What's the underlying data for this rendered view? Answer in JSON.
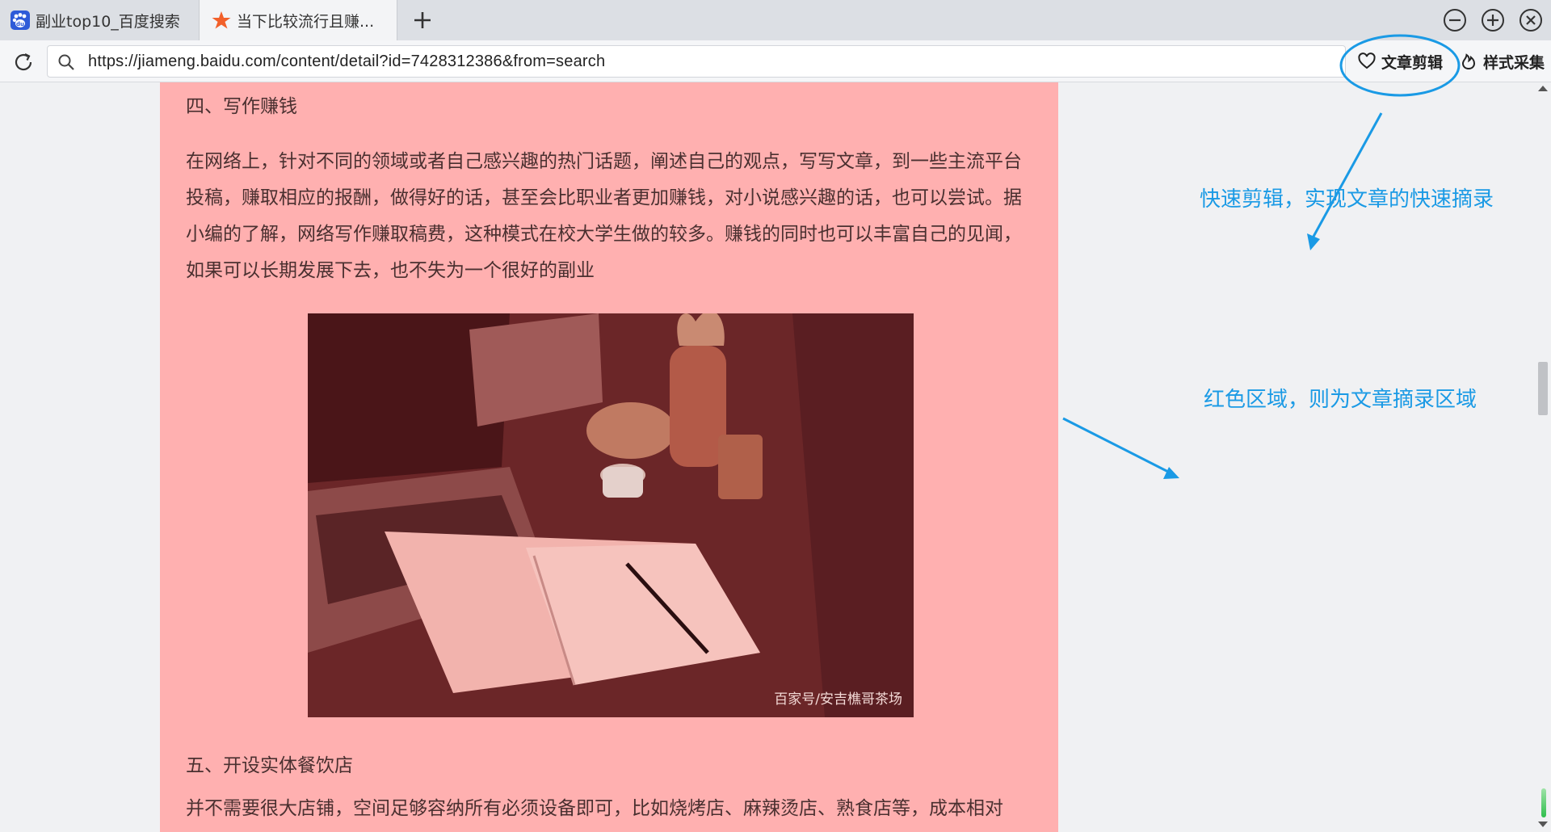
{
  "tabs": [
    {
      "title": "副业top10_百度搜索",
      "icon": "baidu-paw-icon",
      "active": false
    },
    {
      "title": "当下比较流行且赚...",
      "icon": "orange-star-icon",
      "active": true
    }
  ],
  "window_controls": [
    "minimize-icon",
    "maximize-icon",
    "close-icon"
  ],
  "address_bar": {
    "url": "https://jiameng.baidu.com/content/detail?id=7428312386&from=search"
  },
  "toolbar": {
    "clip_label": "文章剪辑",
    "style_label": "样式采集"
  },
  "article": {
    "heading4": "四、写作赚钱",
    "para4": "在网络上，针对不同的领域或者自己感兴趣的热门话题，阐述自己的观点，写写文章，到一些主流平台投稿，赚取相应的报酬，做得好的话，甚至会比职业者更加赚钱，对小说感兴趣的话，也可以尝试。据小编的了解，网络写作赚取稿费，这种模式在校大学生做的较多。赚钱的同时也可以丰富自己的见闻，如果可以长期发展下去，也不失为一个很好的副业",
    "image_watermark": "百家号/安吉樵哥茶场",
    "heading5": "五、开设实体餐饮店",
    "para5": "并不需要很大店铺，空间足够容纳所有必须设备即可，比如烧烤店、麻辣烫店、熟食店等，成本相对低，"
  },
  "annotations": {
    "quick_clip": "快速剪辑，实现文章的快速摘录",
    "red_area": "红色区域，则为文章摘录区域"
  },
  "colors": {
    "highlight": "#ffb0b0",
    "annotation": "#1a9ae5"
  }
}
